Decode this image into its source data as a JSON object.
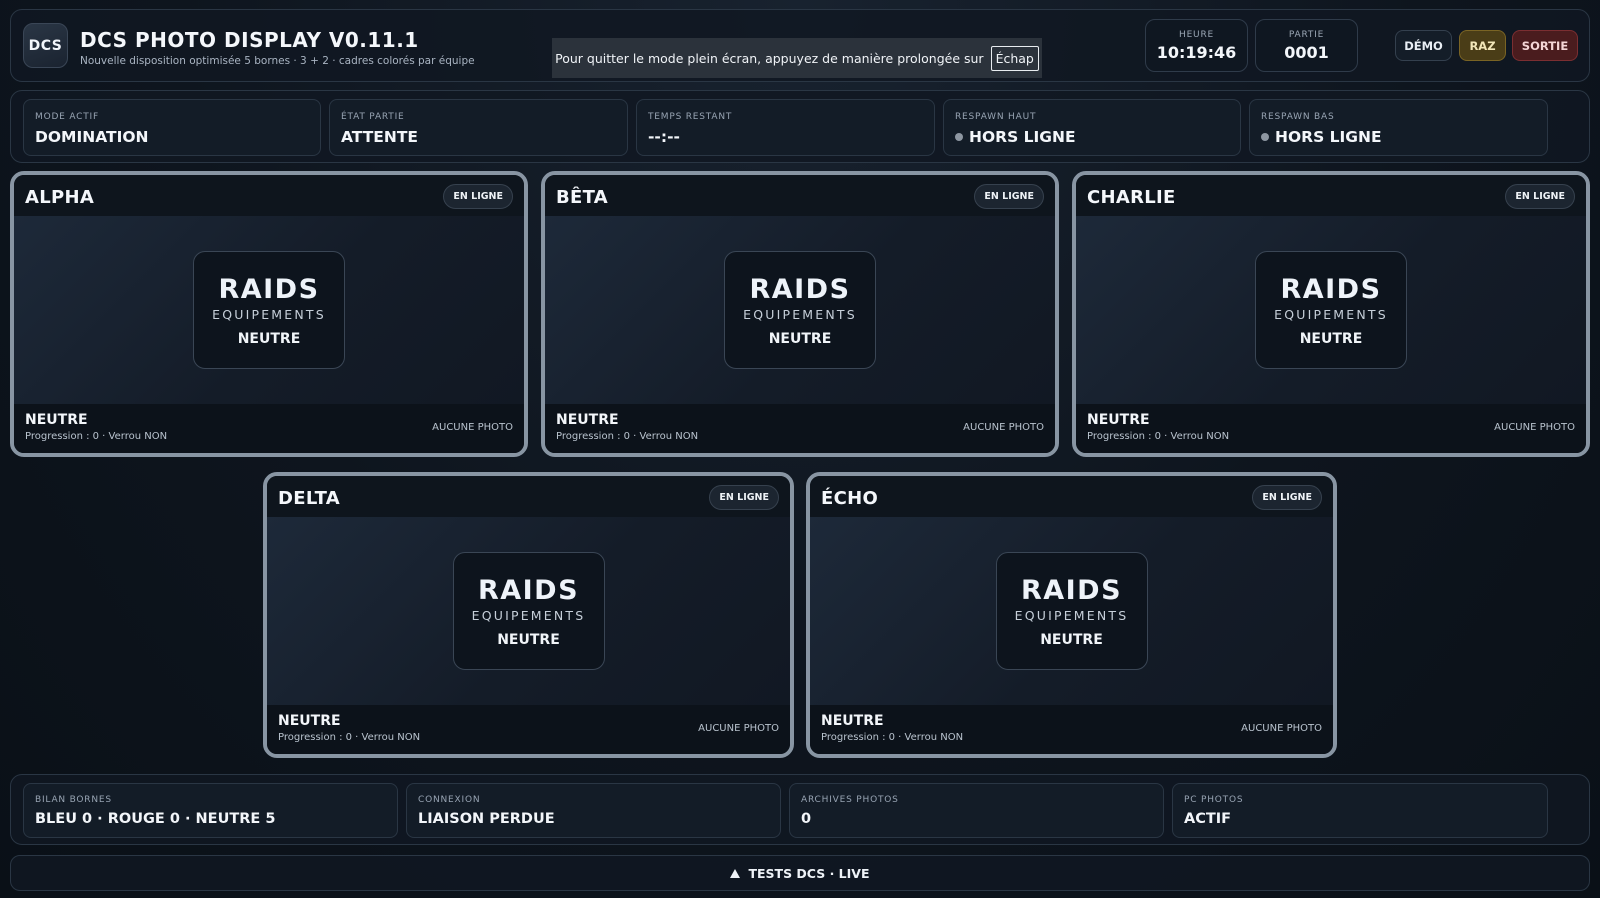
{
  "header": {
    "logo": "DCS",
    "title": "DCS PHOTO DISPLAY V0.11.1",
    "subtitle": "Nouvelle disposition optimisée 5 bornes · 3 + 2 · cadres colorés par équipe",
    "fullscreen_notice": "Pour quitter le mode plein écran, appuyez de manière prolongée sur",
    "fullscreen_key": "Échap",
    "clock_label": "HEURE",
    "clock_value": "10:19:46",
    "game_label": "PARTIE",
    "game_value": "0001",
    "demo_label": "DÉMO",
    "raz_label": "RAZ",
    "exit_label": "SORTIE"
  },
  "status": [
    {
      "label": "MODE ACTIF",
      "value": "DOMINATION",
      "dot": false
    },
    {
      "label": "ÉTAT PARTIE",
      "value": "ATTENTE",
      "dot": false
    },
    {
      "label": "TEMPS RESTANT",
      "value": "--:--",
      "dot": false
    },
    {
      "label": "RESPAWN HAUT",
      "value": "HORS LIGNE",
      "dot": true
    },
    {
      "label": "RESPAWN BAS",
      "value": "HORS LIGNE",
      "dot": true
    }
  ],
  "teams": [
    {
      "name": "ALPHA",
      "badge": "EN LIGNE",
      "raid_title": "RAIDS",
      "raid_sub": "EQUIPEMENTS",
      "raid_status": "NEUTRE",
      "state": "NEUTRE",
      "progress": "Progression : 0 · Verrou NON",
      "photo": "AUCUNE PHOTO"
    },
    {
      "name": "BÊTA",
      "badge": "EN LIGNE",
      "raid_title": "RAIDS",
      "raid_sub": "EQUIPEMENTS",
      "raid_status": "NEUTRE",
      "state": "NEUTRE",
      "progress": "Progression : 0 · Verrou NON",
      "photo": "AUCUNE PHOTO"
    },
    {
      "name": "CHARLIE",
      "badge": "EN LIGNE",
      "raid_title": "RAIDS",
      "raid_sub": "EQUIPEMENTS",
      "raid_status": "NEUTRE",
      "state": "NEUTRE",
      "progress": "Progression : 0 · Verrou NON",
      "photo": "AUCUNE PHOTO"
    },
    {
      "name": "DELTA",
      "badge": "EN LIGNE",
      "raid_title": "RAIDS",
      "raid_sub": "EQUIPEMENTS",
      "raid_status": "NEUTRE",
      "state": "NEUTRE",
      "progress": "Progression : 0 · Verrou NON",
      "photo": "AUCUNE PHOTO"
    },
    {
      "name": "ÉCHO",
      "badge": "EN LIGNE",
      "raid_title": "RAIDS",
      "raid_sub": "EQUIPEMENTS",
      "raid_status": "NEUTRE",
      "state": "NEUTRE",
      "progress": "Progression : 0 · Verrou NON",
      "photo": "AUCUNE PHOTO"
    }
  ],
  "summary": [
    {
      "label": "BILAN BORNES",
      "value": "BLEU 0 · ROUGE 0 · NEUTRE 5"
    },
    {
      "label": "CONNEXION",
      "value": "LIAISON PERDUE"
    },
    {
      "label": "ARCHIVES PHOTOS",
      "value": "0"
    },
    {
      "label": "PC PHOTOS",
      "value": "ACTIF"
    }
  ],
  "footer": {
    "label": "TESTS DCS · LIVE",
    "icon": "triangle-up-icon"
  },
  "colors": {
    "team_border": "#8895a3",
    "raz": "#4a3d17",
    "sortie": "#4a1c1e"
  }
}
